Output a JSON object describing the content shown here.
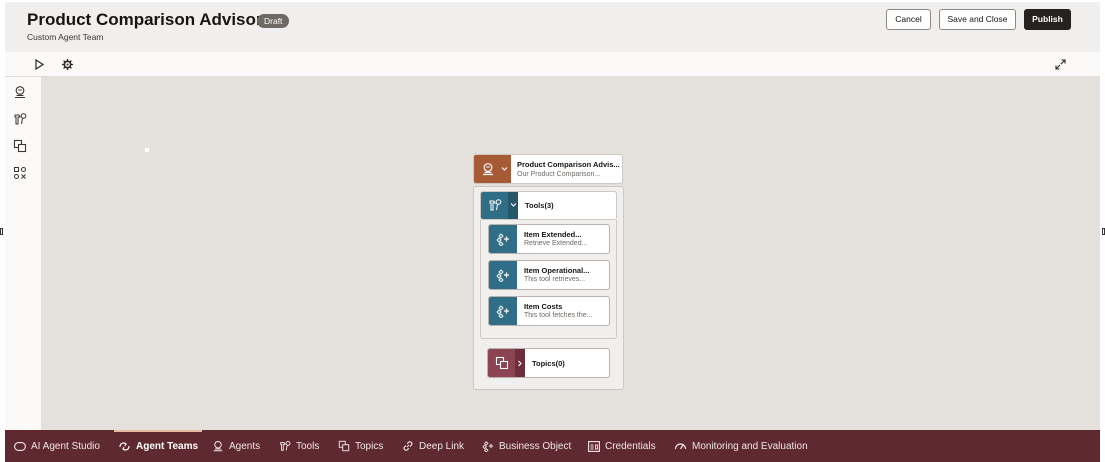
{
  "header": {
    "title": "Product Comparison Advisor",
    "badge": "Draft",
    "subtitle": "Custom Agent Team",
    "cancel_label": "Cancel",
    "save_close_label": "Save and Close",
    "publish_label": "Publish"
  },
  "toolbar": {
    "icons": [
      "play-icon",
      "gear-icon",
      "expand-icon"
    ]
  },
  "rail": {
    "icons": [
      "agent-icon",
      "tools-icon",
      "topics-icon",
      "nodes-icon"
    ]
  },
  "agent_node": {
    "title": "Product Comparison Advis...",
    "subtitle": "Our Product Comparison..."
  },
  "tools_node": {
    "label": "Tools(3)",
    "items": [
      {
        "title": "Item Extended...",
        "subtitle": "Retrieve Extended..."
      },
      {
        "title": "Item Operational...",
        "subtitle": "This tool retrieves..."
      },
      {
        "title": "Item Costs",
        "subtitle": "This tool fetches the..."
      }
    ]
  },
  "topics_node": {
    "label": "Topics(0)"
  },
  "bottom_nav": {
    "items": [
      {
        "label": "AI Agent Studio",
        "icon": "studio-icon"
      },
      {
        "label": "Agent Teams",
        "icon": "agent-teams-icon",
        "active": true
      },
      {
        "label": "Agents",
        "icon": "agents-icon"
      },
      {
        "label": "Tools",
        "icon": "tools-icon"
      },
      {
        "label": "Topics",
        "icon": "topics-icon"
      },
      {
        "label": "Deep Link",
        "icon": "link-icon"
      },
      {
        "label": "Business Object",
        "icon": "business-object-icon"
      },
      {
        "label": "Credentials",
        "icon": "credentials-icon"
      },
      {
        "label": "Monitoring and Evaluation",
        "icon": "monitoring-icon"
      }
    ]
  },
  "colors": {
    "agent": "#a65a36",
    "tool": "#2f6e86",
    "topic": "#8c4352",
    "nav_bg": "#5f2a2f",
    "canvas_bg": "#e4e1dc"
  }
}
